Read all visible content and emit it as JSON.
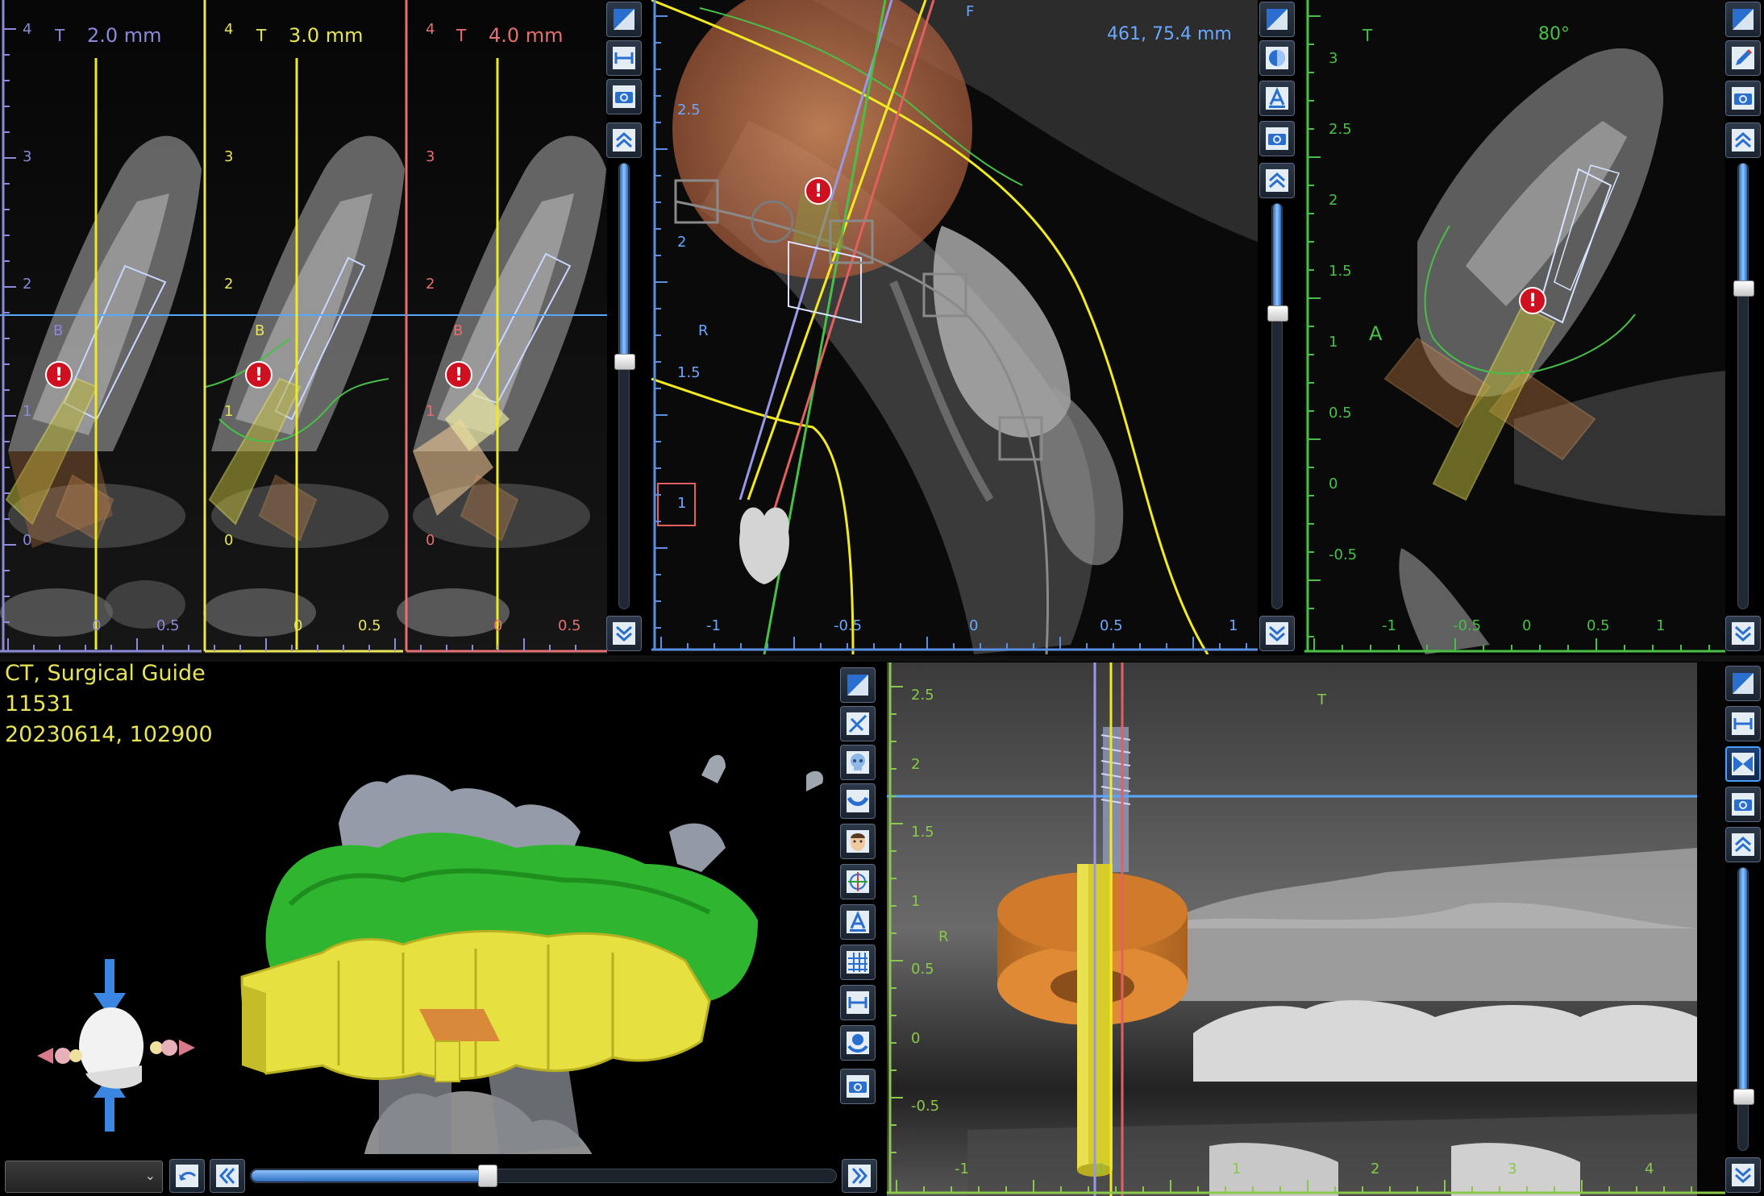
{
  "top_left_panels": [
    {
      "label": "T",
      "thickness": "2.0 mm",
      "color": "#8a8ad8",
      "y_ticks": [
        "4",
        "3",
        "2",
        "1",
        "0"
      ],
      "x_ticks": [
        "0",
        "0.5"
      ],
      "marker": "B"
    },
    {
      "label": "T",
      "thickness": "3.0 mm",
      "color": "#e8e45a",
      "y_ticks": [
        "4",
        "3",
        "2",
        "1",
        "0"
      ],
      "x_ticks": [
        "0",
        "0.5"
      ],
      "marker": "B"
    },
    {
      "label": "T",
      "thickness": "4.0 mm",
      "color": "#e47070",
      "y_ticks": [
        "4",
        "3",
        "2",
        "1",
        "0"
      ],
      "x_ticks": [
        "0",
        "0.5"
      ],
      "marker": "B"
    }
  ],
  "axial_view": {
    "measurement": "461, 75.4 mm",
    "orientation_top": "F",
    "orientation_left": "R",
    "y_ticks": [
      "2.5",
      "2",
      "1.5",
      "1"
    ],
    "x_ticks": [
      "-1",
      "-0.5",
      "0",
      "0.5",
      "1"
    ],
    "box_label": "1"
  },
  "top_right_view": {
    "label": "T",
    "angle": "80°",
    "marker": "A",
    "y_ticks": [
      "3",
      "2.5",
      "2",
      "1.5",
      "1",
      "0.5",
      "0",
      "-0.5"
    ],
    "x_ticks": [
      "-1",
      "-0.5",
      "0",
      "0.5",
      "1"
    ]
  },
  "model_view": {
    "info_lines": [
      "CT, Surgical Guide",
      "11531",
      "20230614, 102900"
    ],
    "dropdown_value": "",
    "slider_value": 0.4
  },
  "panoramic_view": {
    "label": "T",
    "side_label": "R",
    "y_ticks": [
      "2.5",
      "2",
      "1.5",
      "1",
      "0.5",
      "0",
      "-0.5"
    ],
    "x_ticks": [
      "-1",
      "0",
      "1",
      "2",
      "3",
      "4"
    ]
  },
  "toolbars": {
    "left_top": [
      "reset-view-icon",
      "measure-icon",
      "screenshot-icon",
      "scroll-up-icon",
      "scroll-down-icon"
    ],
    "axial": [
      "reset-view-icon",
      "render-mode-icon",
      "annotate-icon",
      "screenshot-icon",
      "scroll-up-icon",
      "scroll-down-icon"
    ],
    "right_top": [
      "reset-view-icon",
      "edit-icon",
      "screenshot-icon",
      "scroll-up-icon",
      "scroll-down-icon"
    ],
    "model": [
      "reset-view-icon",
      "clip-icon",
      "skull-icon",
      "dental-arch-icon",
      "face-icon",
      "axes-icon",
      "annotate-icon",
      "grid-icon",
      "measure-icon",
      "ds-icon",
      "screenshot-icon"
    ],
    "panoramic": [
      "reset-view-icon",
      "measure-icon",
      "ruler-active-icon",
      "screenshot-icon",
      "scroll-up-icon",
      "scroll-down-icon"
    ]
  },
  "sliders": {
    "left_top": 0.44,
    "axial": 0.26,
    "right_top": 0.27,
    "panoramic": 0.82
  }
}
